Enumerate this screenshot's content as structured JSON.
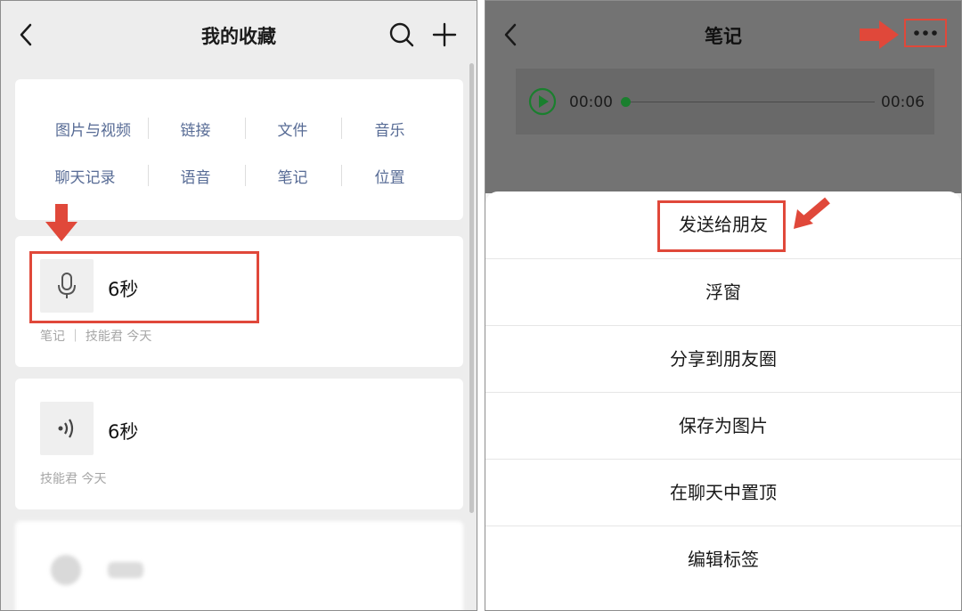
{
  "left": {
    "header": {
      "title": "我的收藏"
    },
    "filters": [
      "图片与视频",
      "链接",
      "文件",
      "音乐",
      "聊天记录",
      "语音",
      "笔记",
      "位置"
    ],
    "items": [
      {
        "title": "6秒",
        "meta": "笔记 ｜ 技能君   今天",
        "icon": "microphone-icon"
      },
      {
        "title": "6秒",
        "meta": "技能君   今天",
        "icon": "voice-wave-icon"
      }
    ]
  },
  "right": {
    "header": {
      "title": "笔记"
    },
    "audio": {
      "current": "00:00",
      "total": "00:06",
      "progress": 0
    },
    "menu": [
      "发送给朋友",
      "浮窗",
      "分享到朋友圈",
      "保存为图片",
      "在聊天中置顶",
      "编辑标签"
    ]
  },
  "colors": {
    "annotation": "#e0483a",
    "play": "#1a7f2e",
    "link": "#576b95"
  },
  "icons": [
    "back-icon",
    "search-icon",
    "plus-icon",
    "more-icon",
    "play-icon",
    "arrow-down-annotation",
    "arrow-right-annotation",
    "arrow-down-left-annotation"
  ]
}
